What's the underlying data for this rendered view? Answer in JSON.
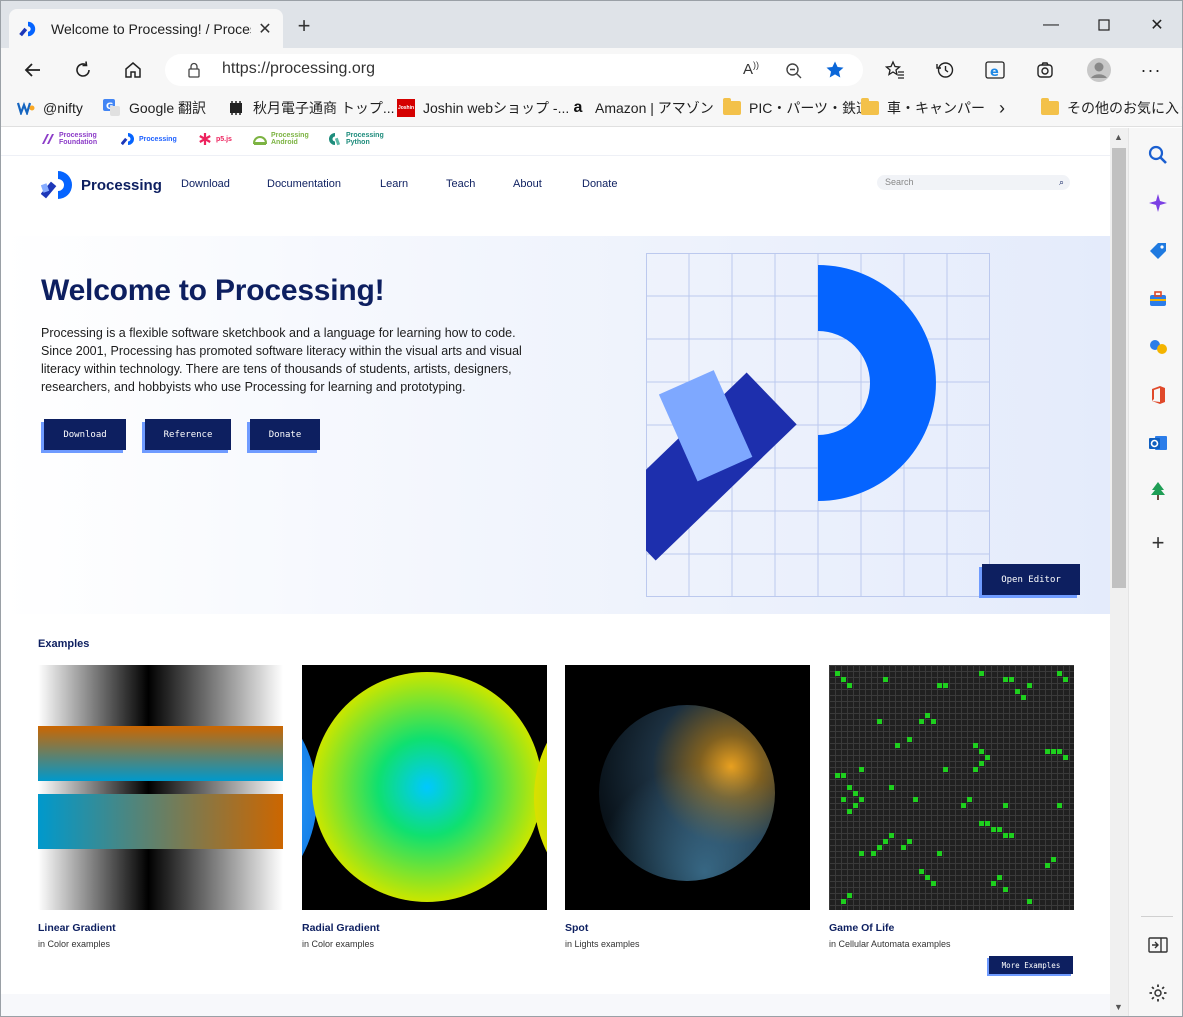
{
  "browser": {
    "tab_title": "Welcome to Processing! / Processing.org",
    "url": "https://processing.org",
    "favorites": [
      {
        "label": "@nifty",
        "icon": "nifty-icon"
      },
      {
        "label": "Google 翻訳",
        "icon": "google-translate-icon"
      },
      {
        "label": "秋月電子通商 トップ...",
        "icon": "akizuki-icon"
      },
      {
        "label": "Joshin webショップ -...",
        "icon": "joshin-icon"
      },
      {
        "label": "Amazon | アマゾン",
        "icon": "amazon-icon"
      },
      {
        "label": "PIC・パーツ・鉄道",
        "icon": "folder-icon"
      },
      {
        "label": "車・キャンパー",
        "icon": "folder-icon"
      },
      {
        "label": "その他のお気に入り",
        "icon": "folder-icon"
      }
    ],
    "favicon_label": "Joshin"
  },
  "site": {
    "projects": [
      {
        "line1": "Processing",
        "line2": "Foundation",
        "color": "#8c3cc8"
      },
      {
        "line1": "Processing",
        "line2": "",
        "color": "#1d60ff"
      },
      {
        "line1": "p5.js",
        "line2": "",
        "color": "#ed225d"
      },
      {
        "line1": "Processing",
        "line2": "Android",
        "color": "#7cb342"
      },
      {
        "line1": "Processing",
        "line2": "Python",
        "color": "#1e8c7c"
      }
    ],
    "logo_text": "Processing",
    "nav": [
      "Download",
      "Documentation",
      "Learn",
      "Teach",
      "About",
      "Donate"
    ],
    "search_placeholder": "Search"
  },
  "hero": {
    "title": "Welcome to Processing!",
    "description": "Processing is a flexible software sketchbook and a language for learning how to code. Since 2001, Processing has promoted software literacy within the visual arts and visual literacy within technology. There are tens of thousands of students, artists, designers, researchers, and hobbyists who use Processing for learning and prototyping.",
    "buttons": [
      "Download",
      "Reference",
      "Donate"
    ],
    "open_editor": "Open Editor"
  },
  "examples": {
    "heading": "Examples",
    "items": [
      {
        "title": "Linear Gradient",
        "category": "in Color examples"
      },
      {
        "title": "Radial Gradient",
        "category": "in Color examples"
      },
      {
        "title": "Spot",
        "category": "in Lights examples"
      },
      {
        "title": "Game Of Life",
        "category": "in Cellular Automata examples"
      }
    ],
    "more_button": "More Examples"
  },
  "colors": {
    "navy": "#0d1f60",
    "brand_blue": "#0564ff",
    "accent_light": "#6f9bff"
  }
}
